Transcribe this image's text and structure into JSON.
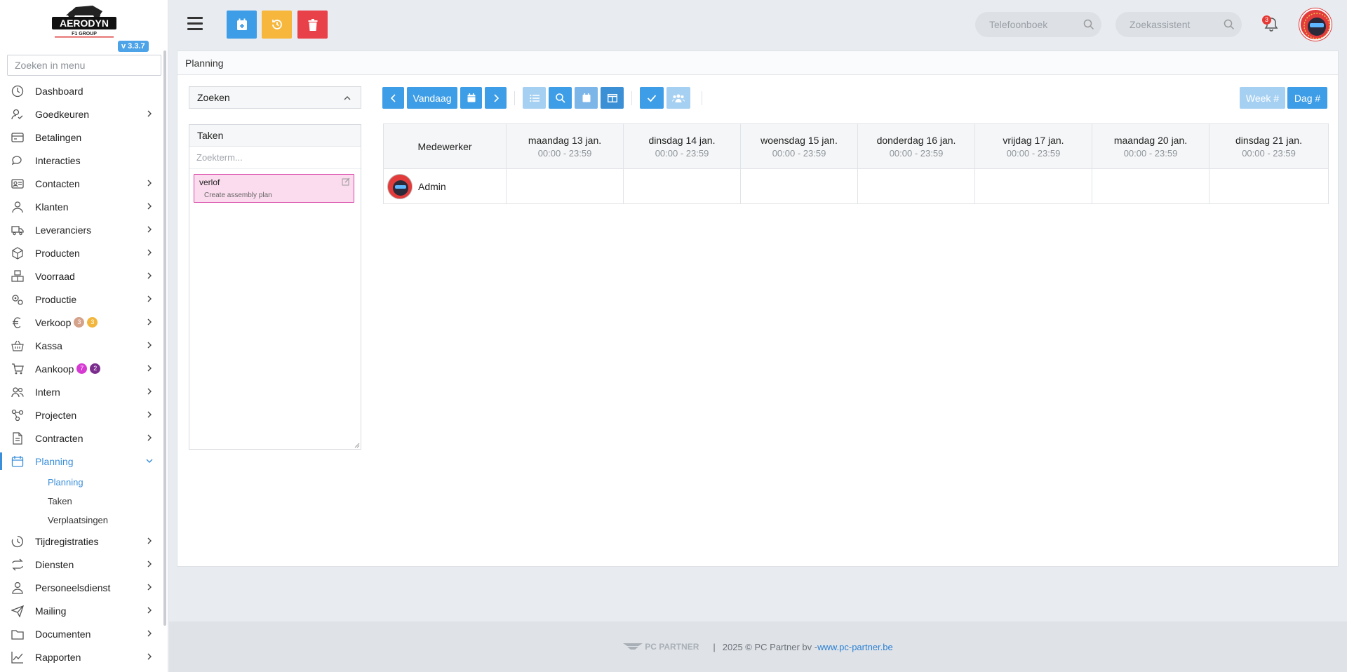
{
  "app": {
    "brand_name": "AERODYN",
    "brand_sub": "F1 GROUP",
    "version": "v 3.3.7"
  },
  "sidebar": {
    "search_placeholder": "Zoeken in menu",
    "items": [
      {
        "label": "Dashboard",
        "icon": "dashboard-icon"
      },
      {
        "label": "Goedkeuren",
        "icon": "user-check-icon"
      },
      {
        "label": "Betalingen",
        "icon": "credit-card-icon"
      },
      {
        "label": "Interacties",
        "icon": "chat-icon"
      },
      {
        "label": "Contacten",
        "icon": "id-card-icon"
      },
      {
        "label": "Klanten",
        "icon": "person-icon"
      },
      {
        "label": "Leveranciers",
        "icon": "truck-icon"
      },
      {
        "label": "Producten",
        "icon": "box-icon"
      },
      {
        "label": "Voorraad",
        "icon": "boxes-icon"
      },
      {
        "label": "Productie",
        "icon": "gears-icon"
      },
      {
        "label": "Verkoop",
        "icon": "euro-icon",
        "badges": [
          "3",
          "3"
        ]
      },
      {
        "label": "Kassa",
        "icon": "basket-icon"
      },
      {
        "label": "Aankoop",
        "icon": "cart-icon",
        "badges": [
          "7",
          "2"
        ]
      },
      {
        "label": "Intern",
        "icon": "users-icon"
      },
      {
        "label": "Projecten",
        "icon": "project-icon"
      },
      {
        "label": "Contracten",
        "icon": "contract-icon"
      },
      {
        "label": "Planning",
        "icon": "calendar-icon"
      },
      {
        "label": "Tijdregistraties",
        "icon": "clock-icon"
      },
      {
        "label": "Diensten",
        "icon": "repeat-icon"
      },
      {
        "label": "Personeelsdienst",
        "icon": "staff-icon"
      },
      {
        "label": "Mailing",
        "icon": "paper-plane-icon"
      },
      {
        "label": "Documenten",
        "icon": "folder-icon"
      },
      {
        "label": "Rapporten",
        "icon": "chart-line-icon"
      }
    ],
    "planning_sub": [
      "Planning",
      "Taken",
      "Verplaatsingen"
    ],
    "badge_colors": {
      "verkoop": [
        "#d4a28a",
        "#f2b63d"
      ],
      "aankoop": [
        "#d63ad3",
        "#7b2d8e"
      ]
    }
  },
  "topbar": {
    "telefoonboek_placeholder": "Telefoonboek",
    "zoekassistent_placeholder": "Zoekassistent",
    "notifications": "3",
    "colors": {
      "add": "#3d9de6",
      "history": "#f6b73c",
      "delete": "#e9414a"
    }
  },
  "page": {
    "title": "Planning",
    "search_panel": "Zoeken",
    "tasks_panel": "Taken",
    "tasks_placeholder": "Zoekterm...",
    "task": {
      "title": "verlof",
      "subtitle": "Create assembly plan"
    }
  },
  "toolbar": {
    "today": "Vandaag",
    "week": "Week #",
    "day": "Dag #"
  },
  "schedule": {
    "employee_header": "Medewerker",
    "days": [
      {
        "label": "maandag 13 jan.",
        "time": "00:00 - 23:59"
      },
      {
        "label": "dinsdag 14 jan.",
        "time": "00:00 - 23:59"
      },
      {
        "label": "woensdag 15 jan.",
        "time": "00:00 - 23:59"
      },
      {
        "label": "donderdag 16 jan.",
        "time": "00:00 - 23:59"
      },
      {
        "label": "vrijdag 17 jan.",
        "time": "00:00 - 23:59"
      },
      {
        "label": "maandag 20 jan.",
        "time": "00:00 - 23:59"
      },
      {
        "label": "dinsdag 21 jan.",
        "time": "00:00 - 23:59"
      }
    ],
    "employees": [
      "Admin"
    ]
  },
  "footer": {
    "logo_text": "PC PARTNER",
    "separator": "|",
    "copyright": "2025 © PC Partner bv - ",
    "link": "www.pc-partner.be"
  }
}
